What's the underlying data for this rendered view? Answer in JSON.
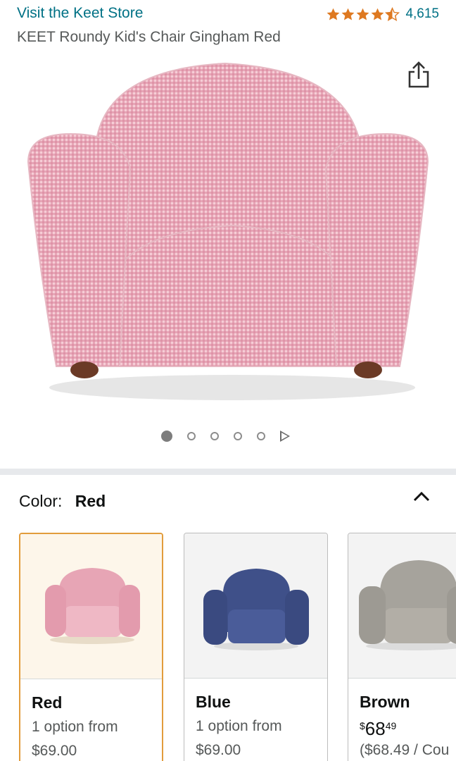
{
  "header": {
    "store_link": "Visit the Keet Store",
    "rating_count": "4,615",
    "rating_value": 4.5,
    "product_title": "KEET Roundy Kid's Chair Gingham Red"
  },
  "gallery": {
    "dot_count": 5,
    "active_index": 0
  },
  "color_selector": {
    "label": "Color:",
    "value": "Red"
  },
  "variants": [
    {
      "name": "Red",
      "line1": "1 option from",
      "line2": "$69.00",
      "swatch": "#e7a5b5"
    },
    {
      "name": "Blue",
      "line1": "1 option from",
      "line2": "$69.00",
      "swatch": "#3f5089"
    },
    {
      "name": "Brown",
      "price_symbol": "$",
      "price_whole": "68",
      "price_fraction": "49",
      "line2": "($68.49 / Cou",
      "swatch": "#a6a39c"
    }
  ],
  "colors": {
    "link": "#007185",
    "star": "#de7921",
    "selected_border": "#e29c3c"
  }
}
